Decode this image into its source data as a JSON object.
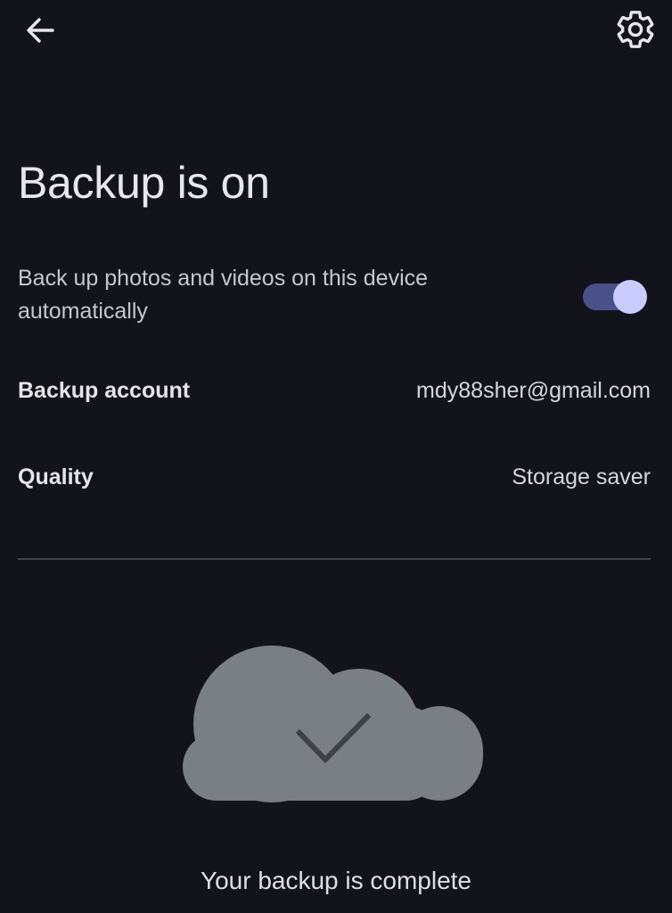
{
  "header": {
    "back_icon": "arrow-left-icon",
    "settings_icon": "gear-icon"
  },
  "title": "Backup is on",
  "auto_backup": {
    "description": "Back up photos and videos on this device automatically",
    "enabled": true,
    "accent_color": "#c8ccff"
  },
  "settings": {
    "account_label": "Backup account",
    "account_value": "mdy88sher@gmail.com",
    "quality_label": "Quality",
    "quality_value": "Storage saver"
  },
  "status": {
    "icon": "cloud-check-icon",
    "text": "Your backup is complete"
  }
}
